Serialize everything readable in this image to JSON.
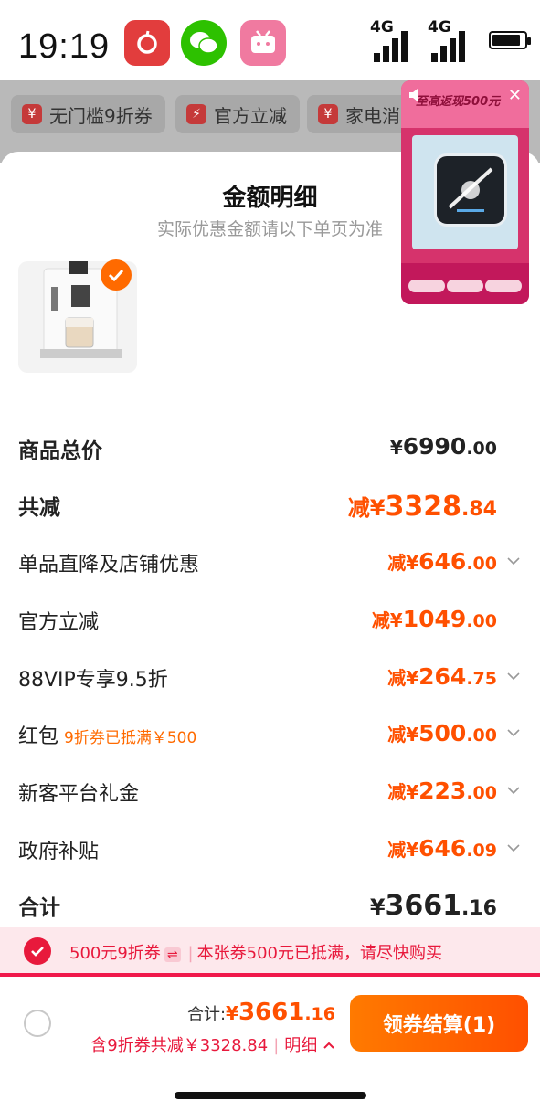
{
  "status_bar": {
    "time": "19:19",
    "network_1": "4G",
    "network_2": "4G",
    "apps": [
      "netease-music-icon",
      "wechat-icon",
      "bilibili-icon"
    ]
  },
  "background": {
    "chips": [
      {
        "icon": "¥",
        "label": "无门槛9折券"
      },
      {
        "icon": "⚡",
        "label": "官方立减"
      },
      {
        "icon": "¥",
        "label": "家电消"
      }
    ]
  },
  "floating_ad": {
    "title": "至高返现500元"
  },
  "sheet": {
    "title": "金额明细",
    "subtitle": "实际优惠金额请以下单页为准"
  },
  "rows": [
    {
      "label": "商品总价",
      "prefix": "¥",
      "int": "6990",
      "dec": ".00",
      "kind": "total"
    },
    {
      "label": "共减",
      "prefix": "减¥",
      "int": "3328",
      "dec": ".84",
      "kind": "sum"
    },
    {
      "label": "单品直降及店铺优惠",
      "prefix": "减¥",
      "int": "646",
      "dec": ".00",
      "arrow": true
    },
    {
      "label": "官方立减",
      "prefix": "减¥",
      "int": "1049",
      "dec": ".00",
      "arrow": false
    },
    {
      "label": "88VIP专享9.5折",
      "prefix": "减¥",
      "int": "264",
      "dec": ".75",
      "arrow": true
    },
    {
      "label": "红包",
      "tag": "9折券已抵满￥500",
      "prefix": "减¥",
      "int": "500",
      "dec": ".00",
      "arrow": true
    },
    {
      "label": "新客平台礼金",
      "prefix": "减¥",
      "int": "223",
      "dec": ".00",
      "arrow": true
    },
    {
      "label": "政府补贴",
      "prefix": "减¥",
      "int": "646",
      "dec": ".09",
      "arrow": true
    },
    {
      "label": "合计",
      "prefix": "¥",
      "int": "3661",
      "dec": ".16",
      "kind": "total"
    }
  ],
  "coupon_strip": {
    "coupon_name": "500元9折券",
    "swap_icon": "⇌",
    "message": "本张券500元已抵满，请尽快购买"
  },
  "bottom_bar": {
    "total_label": "合计:",
    "total_prefix": "¥",
    "total_int": "3661",
    "total_dec": ".16",
    "savings": "含9折券共减￥3328.84",
    "detail_link": "明细",
    "checkout_label": "领券结算(1)"
  },
  "colors": {
    "accent": "#ff5000",
    "coupon_red": "#e8193c"
  }
}
